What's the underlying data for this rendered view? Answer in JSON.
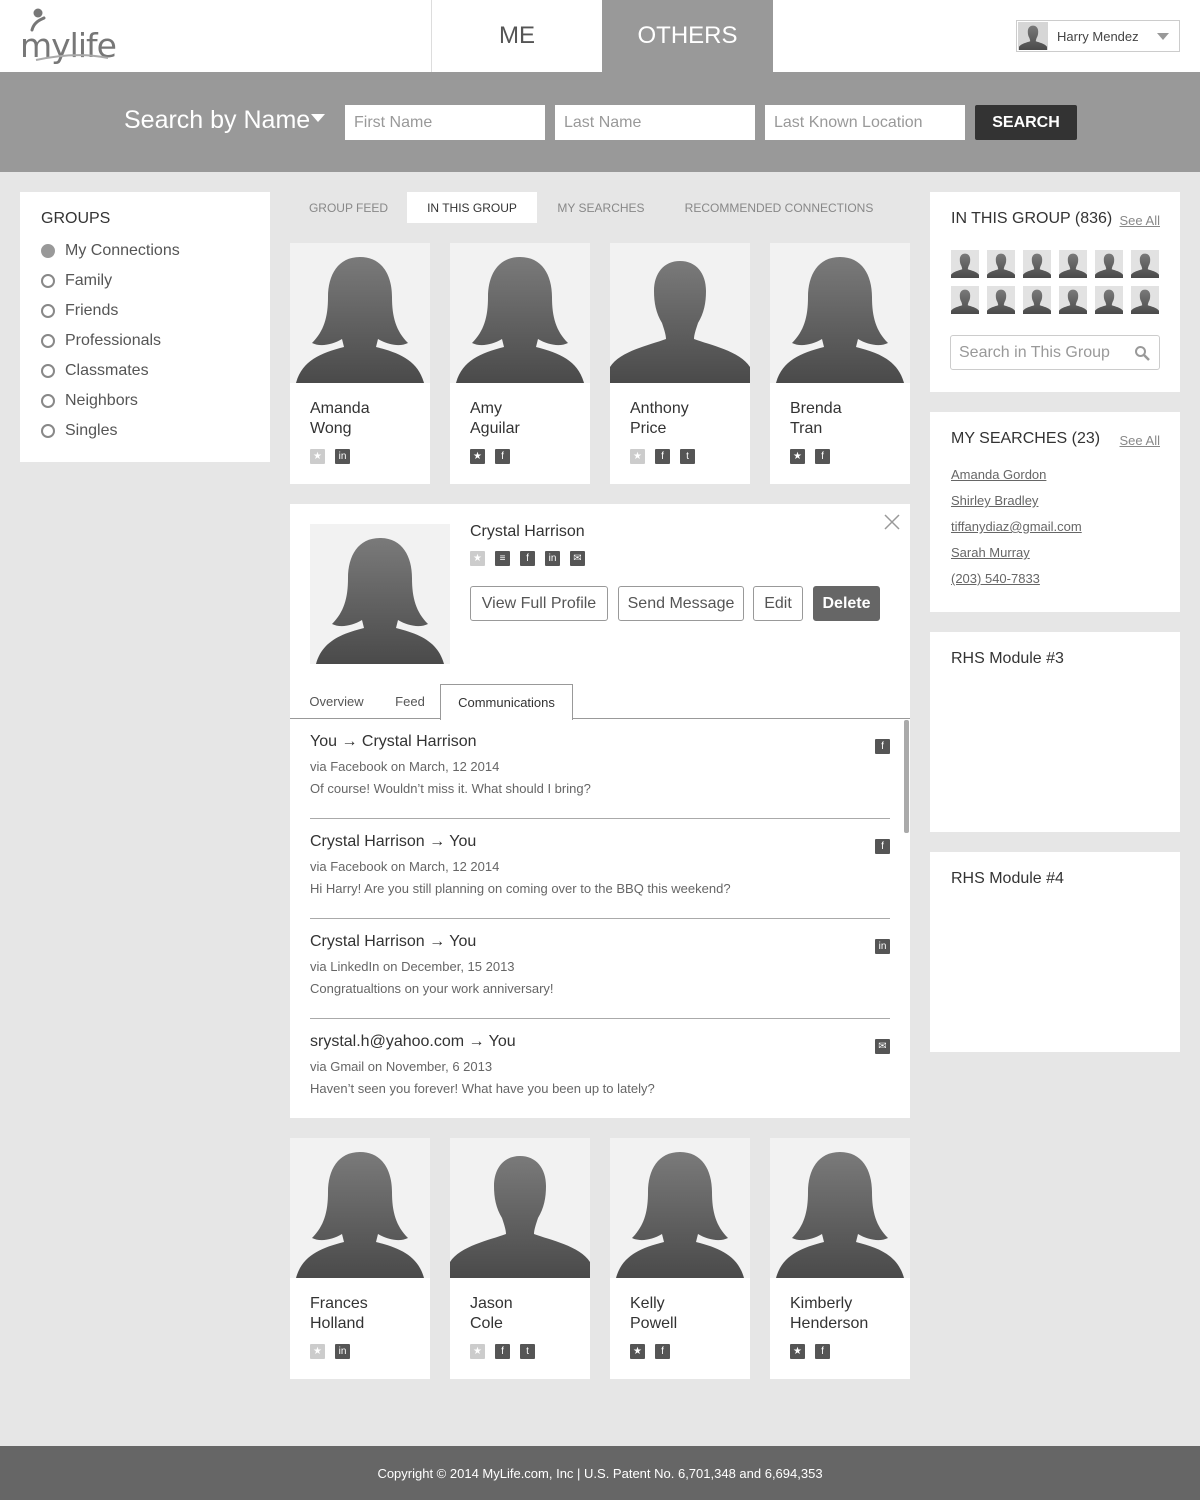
{
  "header": {
    "logo_text": "mylife",
    "tabs": [
      "ME",
      "OTHERS"
    ],
    "user_name": "Harry Mendez"
  },
  "search": {
    "mode_label": "Search by Name",
    "first_name_placeholder": "First Name",
    "last_name_placeholder": "Last Name",
    "location_placeholder": "Last Known Location",
    "button_label": "SEARCH"
  },
  "groups": {
    "title": "GROUPS",
    "items": [
      "My Connections",
      "Family",
      "Friends",
      "Professionals",
      "Classmates",
      "Neighbors",
      "Singles"
    ],
    "selected": "My Connections"
  },
  "subtabs": [
    "GROUP FEED",
    "IN THIS GROUP",
    "MY SEARCHES",
    "RECOMMENDED CONNECTIONS"
  ],
  "active_subtab": "IN THIS GROUP",
  "people_top": [
    {
      "first": "Amanda",
      "last": "Wong",
      "icons": [
        "star-empty",
        "linkedin"
      ]
    },
    {
      "first": "Amy",
      "last": "Aguilar",
      "icons": [
        "star",
        "facebook"
      ]
    },
    {
      "first": "Anthony",
      "last": "Price",
      "icons": [
        "star-empty",
        "facebook",
        "twitter"
      ]
    },
    {
      "first": "Brenda",
      "last": "Tran",
      "icons": [
        "star",
        "facebook"
      ]
    }
  ],
  "people_bottom": [
    {
      "first": "Frances",
      "last": "Holland",
      "icons": [
        "star-empty",
        "linkedin"
      ]
    },
    {
      "first": "Jason",
      "last": "Cole",
      "icons": [
        "star-empty",
        "facebook",
        "twitter"
      ]
    },
    {
      "first": "Kelly",
      "last": "Powell",
      "icons": [
        "star",
        "facebook"
      ]
    },
    {
      "first": "Kimberly",
      "last": "Henderson",
      "icons": [
        "star",
        "facebook"
      ]
    }
  ],
  "detail": {
    "name": "Crystal Harrison",
    "buttons": {
      "view_profile": "View Full Profile",
      "send_message": "Send Message",
      "edit": "Edit",
      "delete": "Delete"
    },
    "tabs": [
      "Overview",
      "Feed",
      "Communications"
    ],
    "active_tab": "Communications",
    "messages": [
      {
        "title": "You → Crystal Harrison",
        "via": "via Facebook on March, 12  2014",
        "text": "Of course! Wouldn’t miss it. What should I bring?",
        "icon": "facebook"
      },
      {
        "title": "Crystal Harrison → You",
        "via": "via Facebook on March, 12  2014",
        "text": "Hi Harry! Are you still planning on coming over to the BBQ this weekend?",
        "icon": "facebook"
      },
      {
        "title": "Crystal Harrison → You",
        "via": "via LinkedIn on December, 15  2013",
        "text": "Congratualtions on your work anniversary!",
        "icon": "linkedin"
      },
      {
        "title": "srystal.h@yahoo.com → You",
        "via": "via Gmail on November, 6  2013",
        "text": "Haven’t seen you forever! What have you been up to lately?",
        "icon": "email"
      }
    ]
  },
  "in_group": {
    "title": "IN THIS GROUP (836)",
    "see_all": "See All",
    "search_placeholder": "Search in This Group"
  },
  "my_searches": {
    "title": "MY SEARCHES (23)",
    "see_all": "See All",
    "items": [
      "Amanda Gordon",
      "Shirley Bradley",
      "tiffanydiaz@gmail.com",
      "Sarah Murray",
      "(203) 540-7833"
    ]
  },
  "rhs_modules": [
    "RHS Module #3",
    "RHS Module #4"
  ],
  "footer": {
    "copyright": "Copyright © 2014 MyLife.com, Inc | U.S. Patent No. 6,701,348 and 6,694,353"
  }
}
